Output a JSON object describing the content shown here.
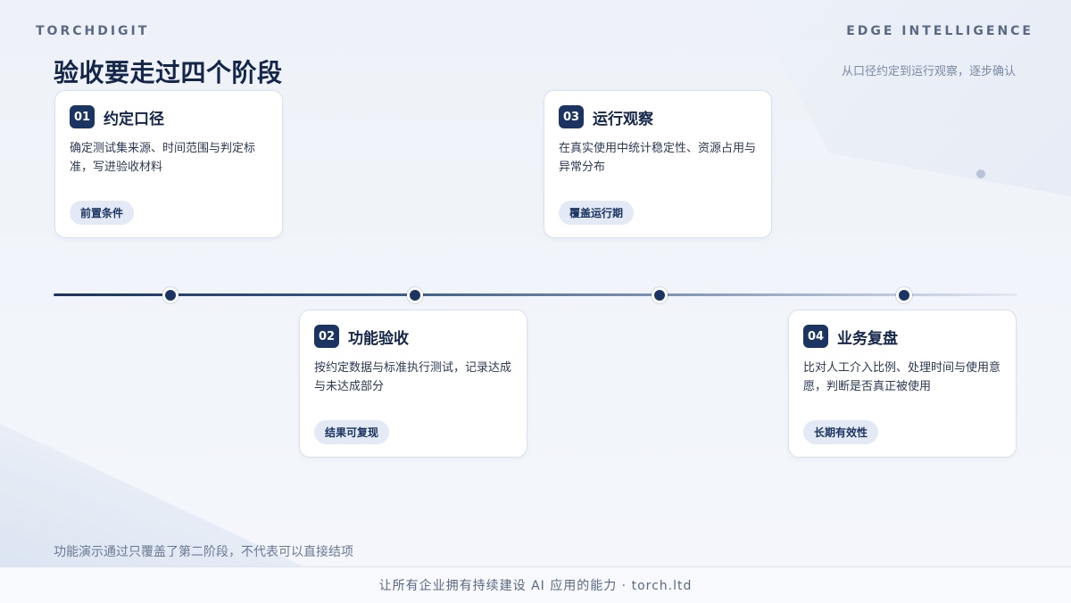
{
  "header": {
    "brand": "TORCHDIGIT",
    "section_tag": "EDGE INTELLIGENCE",
    "title": "验收要走过四个阶段",
    "subtitle": "从口径约定到运行观察，逐步确认"
  },
  "stages": [
    {
      "number": "01",
      "title": "约定口径",
      "description": "确定测试集来源、时间范围与判定标准，写进验收材料",
      "tag": "前置条件"
    },
    {
      "number": "02",
      "title": "功能验收",
      "description": "按约定数据与标准执行测试，记录达成与未达成部分",
      "tag": "结果可复现"
    },
    {
      "number": "03",
      "title": "运行观察",
      "description": "在真实使用中统计稳定性、资源占用与异常分布",
      "tag": "覆盖运行期"
    },
    {
      "number": "04",
      "title": "业务复盘",
      "description": "比对人工介入比例、处理时间与使用意愿，判断是否真正被使用",
      "tag": "长期有效性"
    }
  ],
  "footnote": "功能演示通过只覆盖了第二阶段，不代表可以直接结项",
  "footer": {
    "text": "让所有企业拥有持续建设 AI 应用的能力 · torch.ltd"
  }
}
